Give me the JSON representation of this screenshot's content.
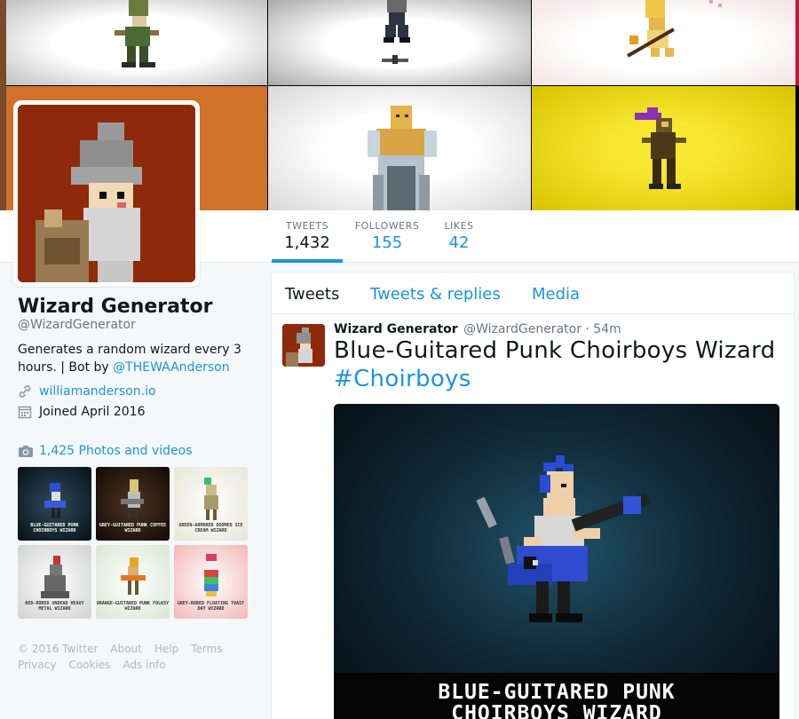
{
  "profile": {
    "name": "Wizard Generator",
    "handle": "@WizardGenerator",
    "bio_text": "Generates a random wizard every 3 hours. | Bot by ",
    "bio_link": "@THEWAAnderson",
    "url": "williamanderson.io",
    "joined": "Joined April 2016",
    "photos_label": "1,425 Photos and videos",
    "thumbnails": [
      {
        "caption": "BLUE-GUITARED PUNK CHOIRBOYS WIZARD"
      },
      {
        "caption": "GREY-GUITARED PUNK COFFEE WIZARD"
      },
      {
        "caption": "GREEN-ARMORED DOOMED ICE CREAM WIZARD"
      },
      {
        "caption": "RED-ROBED UNDEAD HEAVY METAL WIZARD"
      },
      {
        "caption": "ORANGE-GUITARED PUNK FOLKSY WIZARD"
      },
      {
        "caption": "GREY-ROBED FLOATING TOAST DAY WIZARD"
      }
    ]
  },
  "stats": {
    "tweets": {
      "label": "TWEETS",
      "value": "1,432"
    },
    "followers": {
      "label": "FOLLOWERS",
      "value": "155"
    },
    "likes": {
      "label": "LIKES",
      "value": "42"
    }
  },
  "tabs": [
    "Tweets",
    "Tweets & replies",
    "Media"
  ],
  "tweet": {
    "name": "Wizard Generator",
    "handle": "@WizardGenerator · 54m",
    "text": "Blue-Guitared Punk Choirboys Wizard",
    "hashtag": "#Choirboys",
    "media_caption_line1": "BLUE-GUITARED PUNK",
    "media_caption_line2": "CHOIRBOYS WIZARD"
  },
  "footer": [
    "© 2016 Twitter",
    "About",
    "Help",
    "Terms",
    "Privacy",
    "Cookies",
    "Ads info"
  ],
  "colors": {
    "link": "#1b95e0",
    "text": "#14171a",
    "muted": "#657786"
  }
}
